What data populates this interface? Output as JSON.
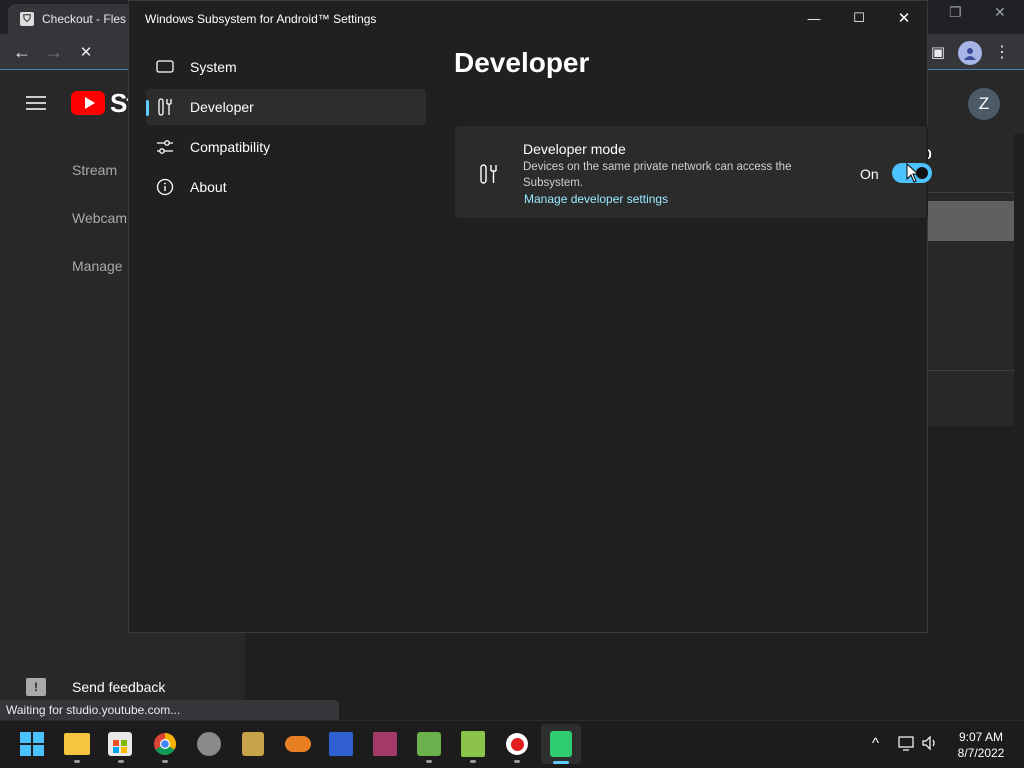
{
  "browser": {
    "tab_title": "Checkout - Fles",
    "status_text": "Waiting for studio.youtube.com...",
    "nav_back": "←",
    "nav_forward": "→",
    "nav_stop": "✕"
  },
  "youtube": {
    "logo_text": "St",
    "avatar_letter": "Z",
    "sidebar": [
      {
        "label": "Stream"
      },
      {
        "label": "Webcam"
      },
      {
        "label": "Manage"
      }
    ],
    "send_feedback": "Send feedback",
    "right_fragment": "0"
  },
  "wsa": {
    "title": "Windows Subsystem for Android™ Settings",
    "nav": [
      {
        "label": "System",
        "icon": "monitor-icon",
        "selected": false
      },
      {
        "label": "Developer",
        "icon": "tools-icon",
        "selected": true
      },
      {
        "label": "Compatibility",
        "icon": "sliders-icon",
        "selected": false
      },
      {
        "label": "About",
        "icon": "info-icon",
        "selected": false
      }
    ],
    "page_title": "Developer",
    "developer_mode": {
      "title": "Developer mode",
      "description": "Devices on the same private network can access the Subsystem.",
      "link": "Manage developer settings",
      "state_label": "On",
      "enabled": true
    }
  },
  "taskbar": {
    "apps": [
      "start-icon",
      "file-explorer-icon",
      "microsoft-store-icon",
      "chrome-icon",
      "raccoon-app-icon",
      "keys-app-icon",
      "cloud-app-icon",
      "save-app-icon",
      "winrar-icon",
      "bluestacks-icon",
      "apk-installer-icon",
      "record-icon",
      "wsa-icon"
    ],
    "time": "9:07 AM",
    "date": "8/7/2022"
  },
  "colors": {
    "accent": "#60cdff",
    "toggle_on": "#4cc2ff",
    "link": "#99ebff",
    "youtube_red": "#ff0000"
  }
}
